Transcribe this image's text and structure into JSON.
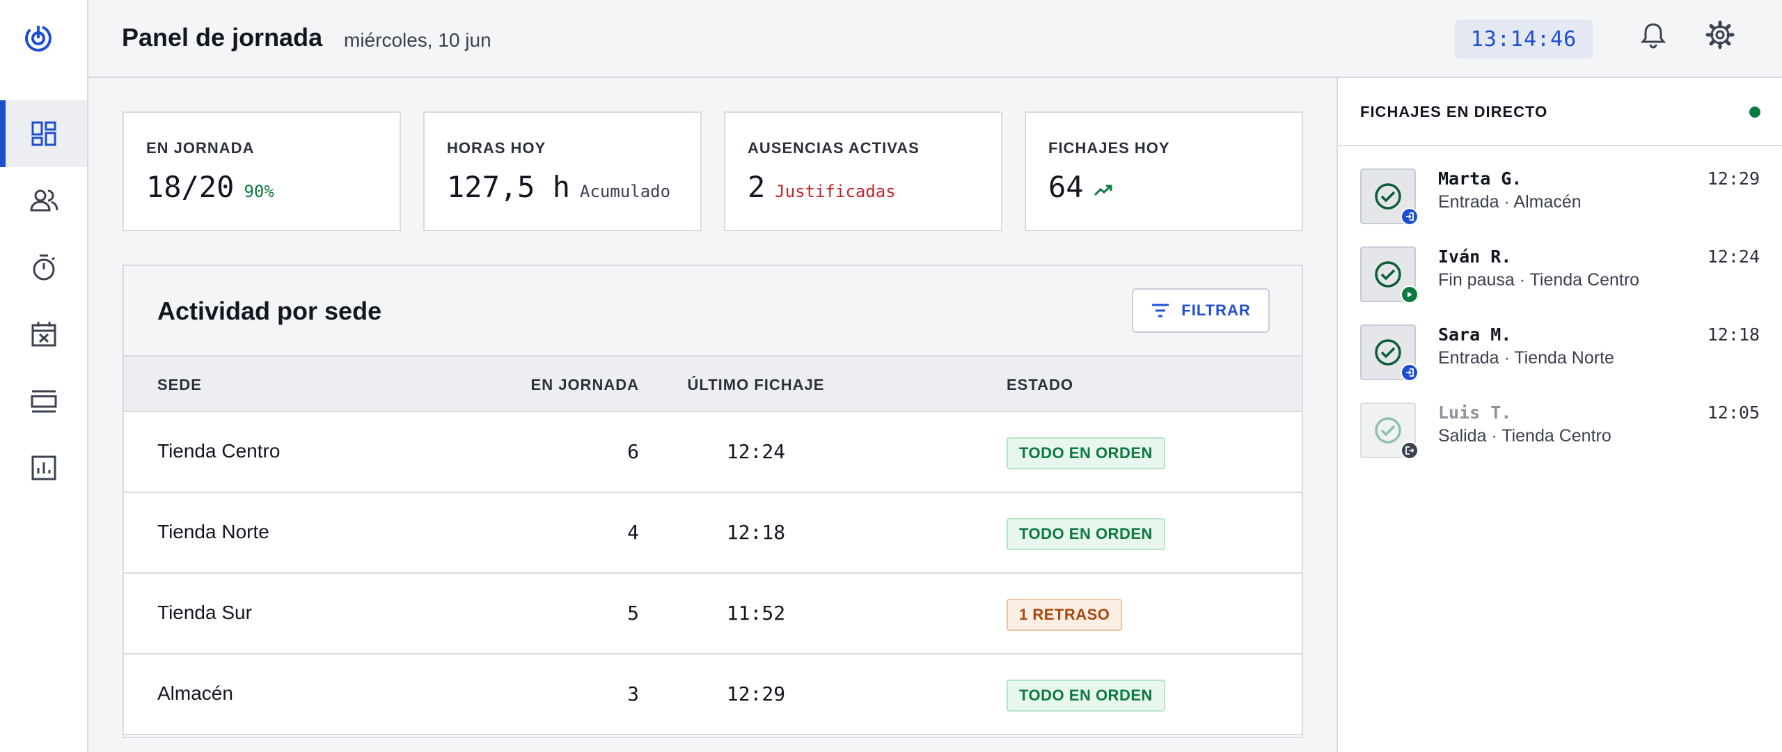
{
  "header": {
    "title": "Panel de jornada",
    "date": "miércoles, 10 jun",
    "clock": "13:14:46"
  },
  "sidebar": {
    "items": [
      {
        "icon": "dashboard-icon",
        "active": true
      },
      {
        "icon": "people-icon",
        "active": false
      },
      {
        "icon": "stopwatch-icon",
        "active": false
      },
      {
        "icon": "calendar-x-icon",
        "active": false
      },
      {
        "icon": "view-agenda-icon",
        "active": false
      },
      {
        "icon": "bar-chart-icon",
        "active": false
      }
    ]
  },
  "stats": [
    {
      "label": "EN JORNADA",
      "value": "18/20",
      "sub": "90%",
      "sub_color": "#0b7a3e"
    },
    {
      "label": "HORAS HOY",
      "value": "127,5 h",
      "sub": "Acumulado",
      "sub_color": "#3b4150"
    },
    {
      "label": "AUSENCIAS ACTIVAS",
      "value": "2",
      "sub": "Justificadas",
      "sub_color": "#c0262d"
    },
    {
      "label": "FICHAJES HOY",
      "value": "64",
      "sub_icon": "trending-up-icon",
      "sub_color": "#0b7a3e"
    }
  ],
  "activity": {
    "title": "Actividad por sede",
    "filter_label": "FILTRAR",
    "columns": [
      "SEDE",
      "EN JORNADA",
      "ÚLTIMO FICHAJE",
      "ESTADO"
    ],
    "rows": [
      {
        "sede": "Tienda Centro",
        "en_jornada": "6",
        "ultimo": "12:24",
        "estado": "TODO EN ORDEN",
        "tone": "ok"
      },
      {
        "sede": "Tienda Norte",
        "en_jornada": "4",
        "ultimo": "12:18",
        "estado": "TODO EN ORDEN",
        "tone": "ok"
      },
      {
        "sede": "Tienda Sur",
        "en_jornada": "5",
        "ultimo": "11:52",
        "estado": "1 RETRASO",
        "tone": "warn"
      },
      {
        "sede": "Almacén",
        "en_jornada": "3",
        "ultimo": "12:29",
        "estado": "TODO EN ORDEN",
        "tone": "ok"
      }
    ]
  },
  "feed": {
    "title": "FICHAJES EN DIRECTO",
    "items": [
      {
        "name": "Marta G.",
        "detail": "Entrada · Almacén",
        "time": "12:29",
        "badge": "login-icon"
      },
      {
        "name": "Iván R.",
        "detail": "Fin pausa · Tienda Centro",
        "time": "12:24",
        "badge": "play-icon"
      },
      {
        "name": "Sara M.",
        "detail": "Entrada · Tienda Norte",
        "time": "12:18",
        "badge": "login-icon"
      },
      {
        "name": "Luis T.",
        "detail": "Salida · Tienda Centro",
        "time": "12:05",
        "badge": "logout-icon"
      }
    ]
  },
  "colors": {
    "accent": "#1f4fd1",
    "ok": "#0b7a3e",
    "warn": "#a34a10",
    "danger": "#c0262d"
  }
}
